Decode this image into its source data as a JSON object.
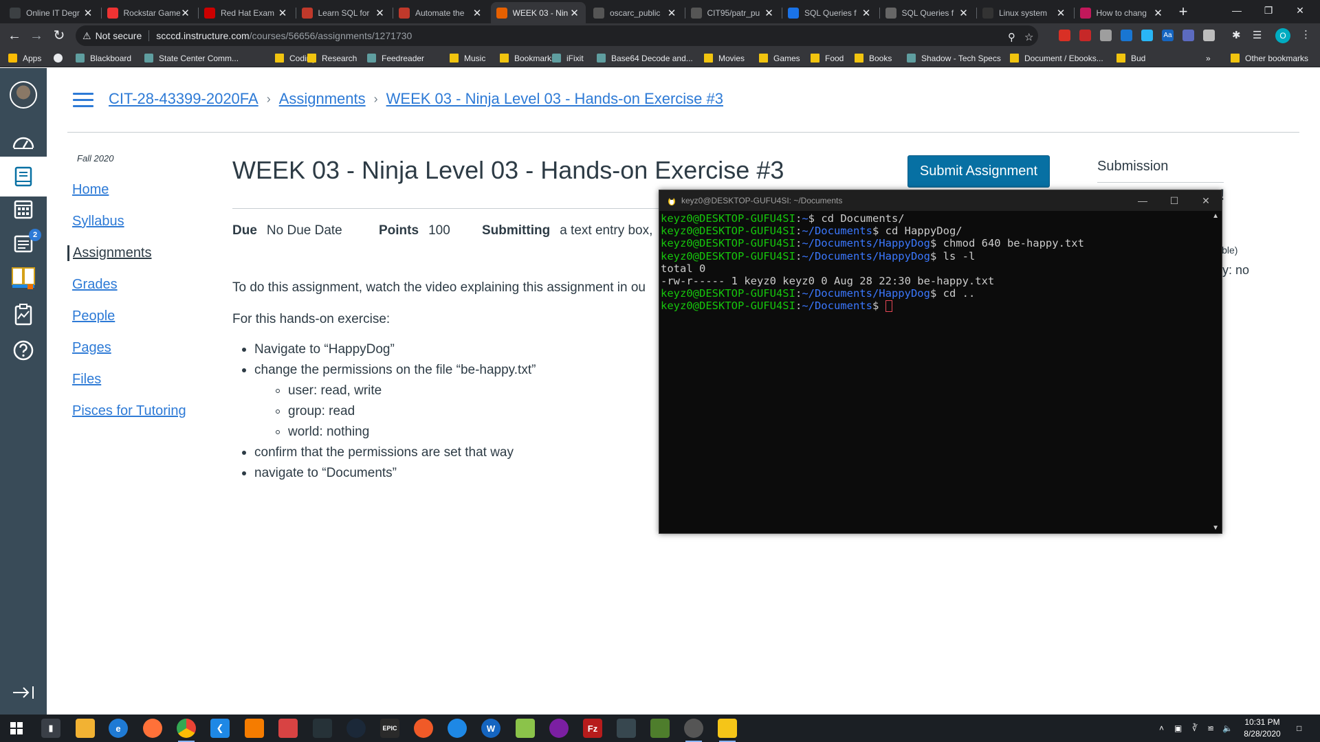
{
  "browser": {
    "tabs": [
      {
        "title": "Online IT Degr",
        "favicon_color": "#3c4043"
      },
      {
        "title": "Rockstar Game",
        "favicon_color": "#e33"
      },
      {
        "title": "Red Hat Exam",
        "favicon_color": "#c00"
      },
      {
        "title": "Learn SQL for",
        "favicon_color": "#c0392b"
      },
      {
        "title": "Automate the",
        "favicon_color": "#c0392b"
      },
      {
        "title": "WEEK 03 - Nin",
        "favicon_color": "#e66000",
        "active": true
      },
      {
        "title": "oscarc_public",
        "favicon_color": "#555"
      },
      {
        "title": "CIT95/patr_pu",
        "favicon_color": "#555"
      },
      {
        "title": "SQL Queries f",
        "favicon_color": "#1a73e8"
      },
      {
        "title": "SQL Queries f",
        "favicon_color": "#666"
      },
      {
        "title": "Linux system",
        "favicon_color": "#333"
      },
      {
        "title": "How to chang",
        "favicon_color": "#c2185b"
      }
    ],
    "close_glyph": "✕",
    "new_tab_glyph": "+",
    "url_warning": "Not secure",
    "url_host": "scccd.instructure.com",
    "url_path": "/courses/56656/assignments/1271730",
    "bookmarks": [
      {
        "label": "Apps",
        "kind": "apps"
      },
      {
        "label": "",
        "kind": "icon"
      },
      {
        "label": "Blackboard",
        "kind": "site"
      },
      {
        "label": "State Center Comm...",
        "kind": "site"
      },
      {
        "label": "Coding",
        "kind": "folder"
      },
      {
        "label": "Research",
        "kind": "folder"
      },
      {
        "label": "Feedreader",
        "kind": "site"
      },
      {
        "label": "Music",
        "kind": "folder"
      },
      {
        "label": "Bookmarks",
        "kind": "folder"
      },
      {
        "label": "iFixit",
        "kind": "site"
      },
      {
        "label": "Base64 Decode and...",
        "kind": "site"
      },
      {
        "label": "Movies",
        "kind": "folder"
      },
      {
        "label": "Games",
        "kind": "folder"
      },
      {
        "label": "Food",
        "kind": "folder"
      },
      {
        "label": "Books",
        "kind": "folder"
      },
      {
        "label": "Shadow - Tech Specs",
        "kind": "site"
      },
      {
        "label": "Document / Ebooks...",
        "kind": "folder"
      },
      {
        "label": "Bud",
        "kind": "folder"
      }
    ],
    "bookmarks_overflow": "»",
    "other_bookmarks": "Other bookmarks",
    "profile_initial": "O"
  },
  "global_nav": {
    "inbox_badge": "2"
  },
  "breadcrumb": {
    "course": "CIT-28-43399-2020FA",
    "section": "Assignments",
    "current": "WEEK 03 - Ninja Level 03 - Hands-on Exercise #3",
    "separator": "›"
  },
  "course_nav": {
    "term": "Fall 2020",
    "links": [
      "Home",
      "Syllabus",
      "Assignments",
      "Grades",
      "People",
      "Pages",
      "Files",
      "Pisces for Tutoring"
    ],
    "active": "Assignments"
  },
  "assignment": {
    "title": "WEEK 03 - Ninja Level 03 - Hands-on Exercise #3",
    "submit_label": "Submit Assignment",
    "due_label": "Due",
    "due_value": "No Due Date",
    "points_label": "Points",
    "points_value": "100",
    "submitting_label": "Submitting",
    "submitting_value": "a text entry box,",
    "intro": "To do this assignment, watch the video explaining this assignment in ou",
    "lead": "For this hands-on exercise:",
    "steps": [
      {
        "text": "Navigate to “HappyDog”",
        "level": 1
      },
      {
        "text": "change the permissions on the file “be-happy.txt”",
        "level": 1
      },
      {
        "text": "user: read, write",
        "level": 2
      },
      {
        "text": "group: read",
        "level": 2
      },
      {
        "text": "world: nothing",
        "level": 2
      },
      {
        "text": "confirm that the permissions are set that way",
        "level": 1
      },
      {
        "text": "navigate to “Documents”",
        "level": 1
      }
    ]
  },
  "submission_panel": {
    "heading": "Submission",
    "frag_exclaim": "!",
    "frag_ible": "ible)",
    "frag_ly_no": "ly: no"
  },
  "terminal": {
    "title": "keyz0@DESKTOP-GUFU4SI: ~/Documents",
    "prompt_user": "keyz0@DESKTOP-GUFU4SI",
    "lines": [
      {
        "path": "~",
        "cmd": "cd Documents/"
      },
      {
        "path": "~/Documents",
        "cmd": "cd HappyDog/"
      },
      {
        "path": "~/Documents/HappyDog",
        "cmd": "chmod 640 be-happy.txt"
      },
      {
        "path": "~/Documents/HappyDog",
        "cmd": "ls -l"
      },
      {
        "output": "total 0"
      },
      {
        "output": "-rw-r----- 1 keyz0 keyz0 0 Aug 28 22:30 be-happy.txt"
      },
      {
        "path": "~/Documents/HappyDog",
        "cmd": "cd .."
      },
      {
        "path": "~/Documents",
        "cmd": "",
        "cursor": true
      }
    ]
  },
  "taskbar": {
    "time": "10:31 PM",
    "date": "8/28/2020"
  }
}
